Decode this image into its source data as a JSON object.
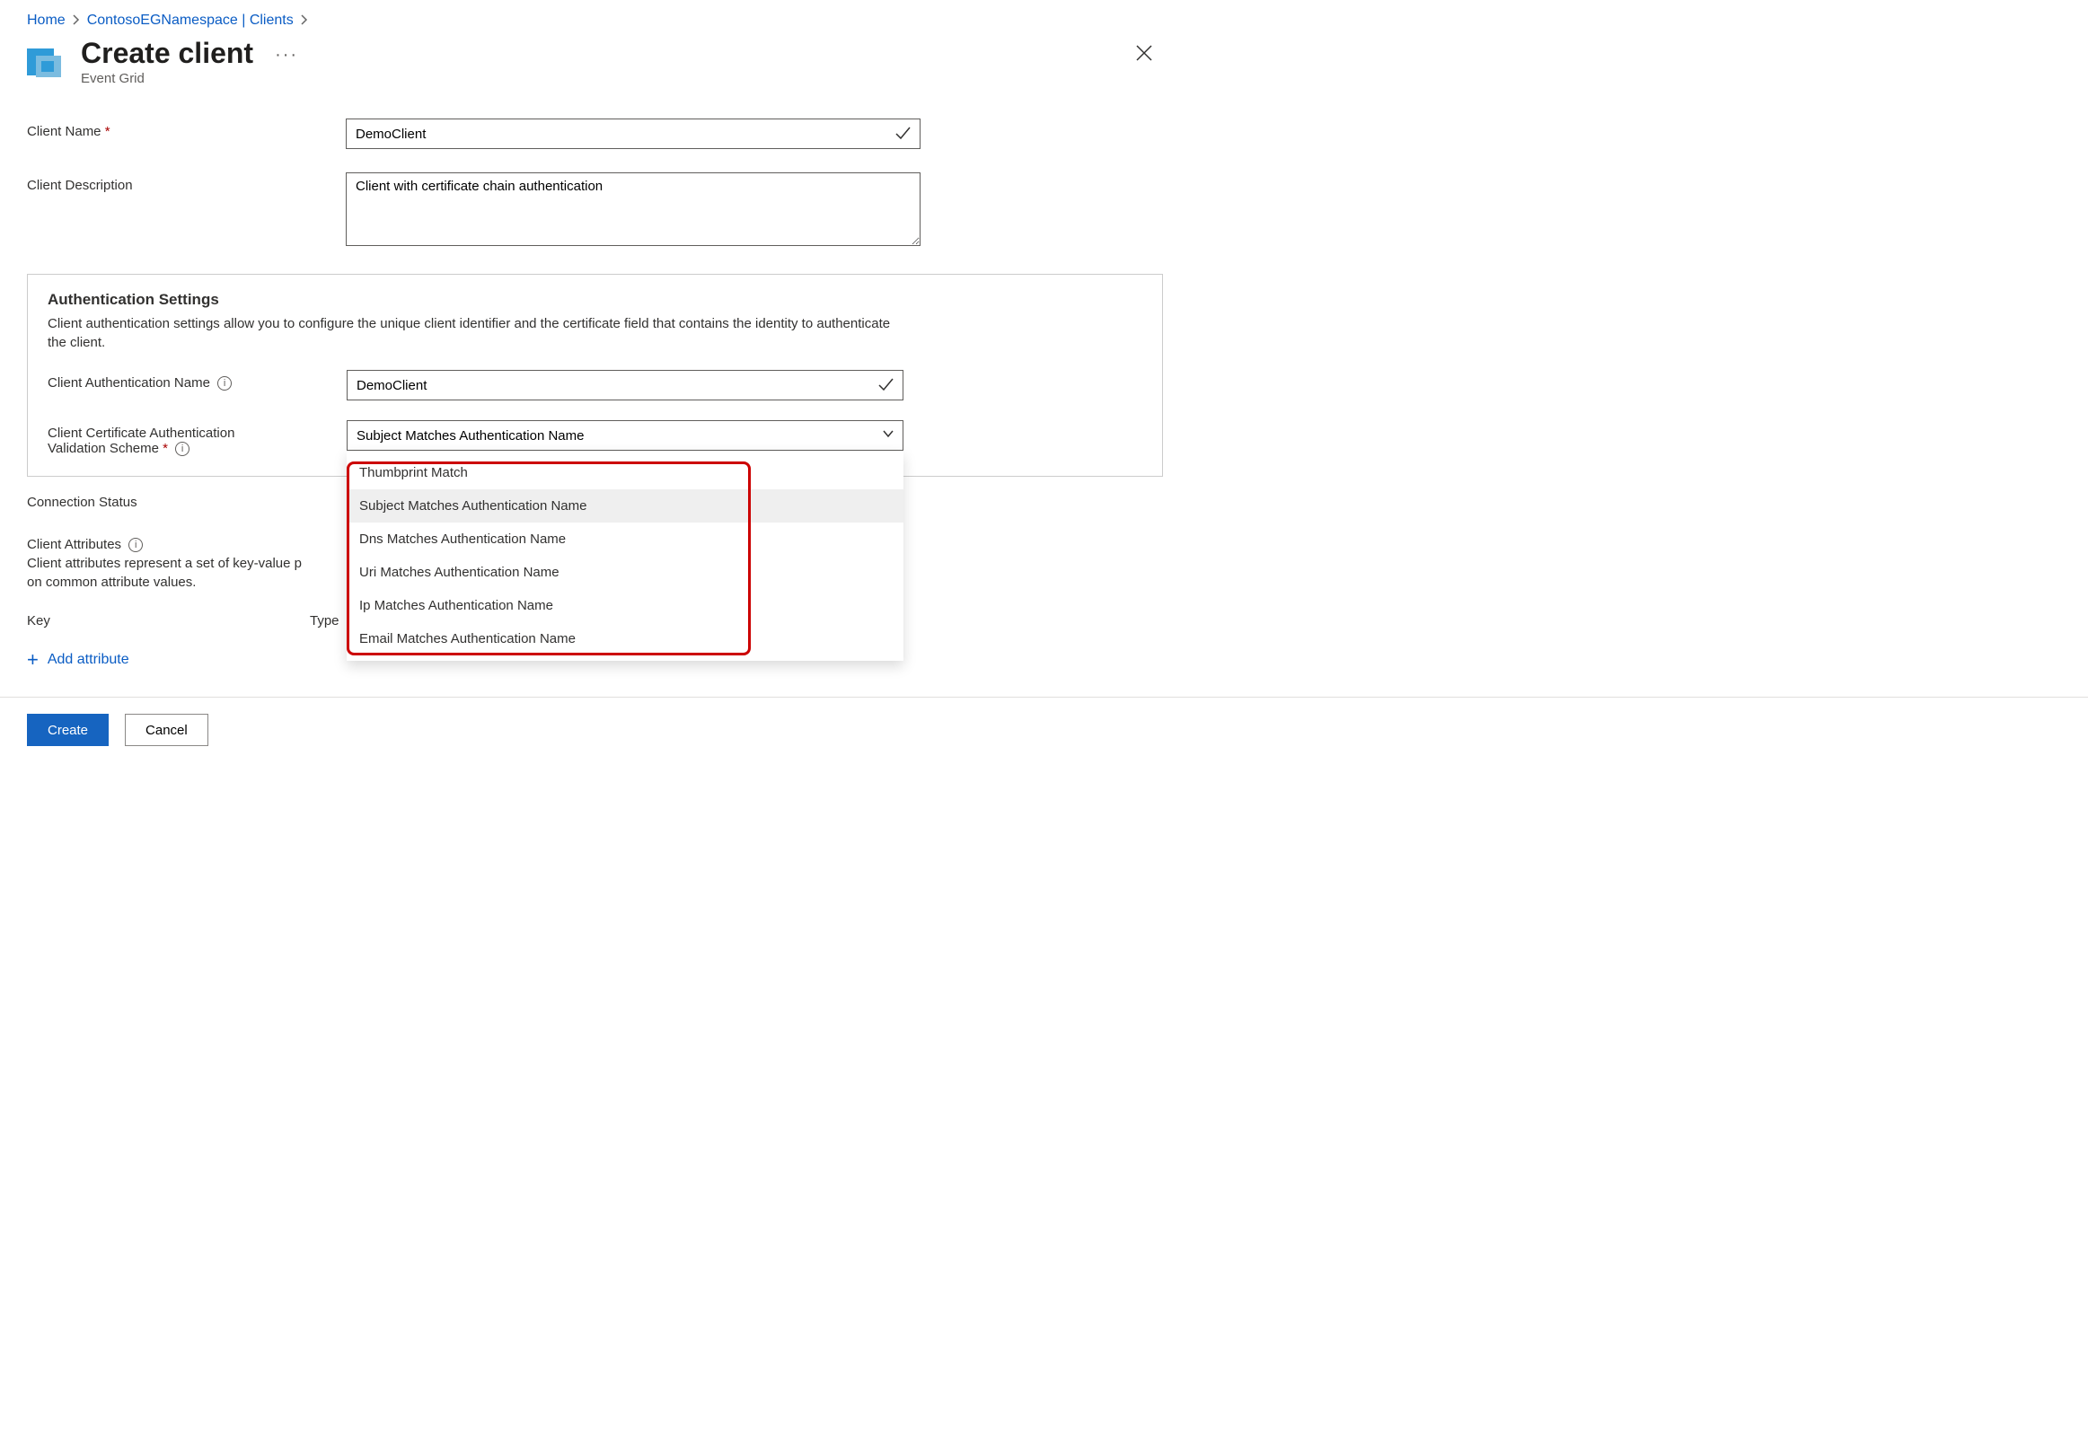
{
  "breadcrumb": {
    "home": "Home",
    "namespace": "ContosoEGNamespace | Clients"
  },
  "header": {
    "title": "Create client",
    "subtitle": "Event Grid"
  },
  "form": {
    "client_name_label": "Client Name",
    "client_name_value": "DemoClient",
    "client_desc_label": "Client Description",
    "client_desc_value": "Client with certificate chain authentication"
  },
  "auth_panel": {
    "title": "Authentication Settings",
    "desc": "Client authentication settings allow you to configure the unique client identifier and the certificate field that contains the identity to authenticate the client.",
    "auth_name_label": "Client Authentication Name",
    "auth_name_value": "DemoClient",
    "scheme_label_1": "Client Certificate Authentication",
    "scheme_label_2": "Validation Scheme",
    "scheme_selected": "Subject Matches Authentication Name",
    "scheme_options": {
      "o0": "Thumbprint Match",
      "o1": "Subject Matches Authentication Name",
      "o2": "Dns Matches Authentication Name",
      "o3": "Uri Matches Authentication Name",
      "o4": "Ip Matches Authentication Name",
      "o5": "Email Matches Authentication Name"
    }
  },
  "connection_status_label": "Connection Status",
  "attributes": {
    "heading": "Client Attributes",
    "desc_prefix": "Client attributes represent a set of key-value p",
    "desc_suffix": "on common attribute values.",
    "key_col": "Key",
    "type_col": "Type",
    "add_label": "Add attribute"
  },
  "footer": {
    "create": "Create",
    "cancel": "Cancel"
  }
}
